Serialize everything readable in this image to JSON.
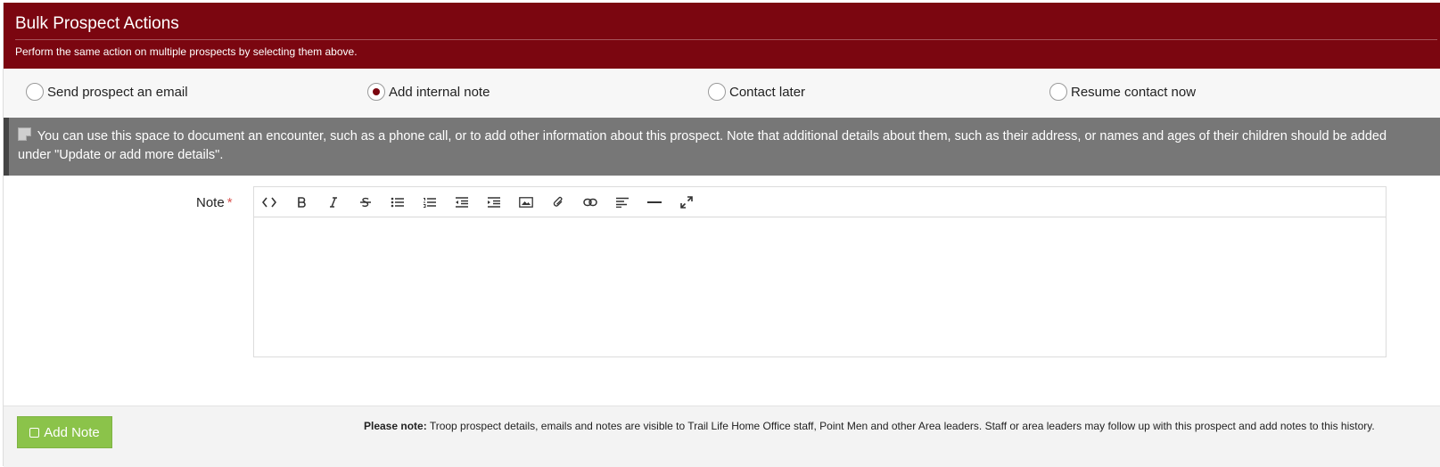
{
  "header": {
    "title": "Bulk Prospect Actions",
    "subtitle": "Perform the same action on multiple prospects by selecting them above."
  },
  "actions": [
    {
      "label": "Send prospect an email",
      "checked": false
    },
    {
      "label": "Add internal note",
      "checked": true
    },
    {
      "label": "Contact later",
      "checked": false
    },
    {
      "label": "Resume contact now",
      "checked": false
    }
  ],
  "info": {
    "text": "You can use this space to document an encounter, such as a phone call, or to add other information about this prospect. Note that additional details about them, such as their address, or names and ages of their children should be added under \"Update or add more details\"."
  },
  "form": {
    "note_label": "Note",
    "required_mark": "*",
    "editor_value": ""
  },
  "toolbar": {
    "tools": [
      "code-icon",
      "bold-icon",
      "italic-icon",
      "strikethrough-icon",
      "bullet-list-icon",
      "numbered-list-icon",
      "outdent-icon",
      "indent-icon",
      "image-icon",
      "attachment-icon",
      "link-icon",
      "align-icon",
      "horizontal-rule-icon",
      "fullscreen-icon"
    ]
  },
  "footer": {
    "add_button_label": "Add Note",
    "please_note_bold": "Please note:",
    "please_note_text": " Troop prospect details, emails and notes are visible to Trail Life Home Office staff, Point Men and other Area leaders. Staff or area leaders may follow up with this prospect and add notes to this history."
  },
  "colors": {
    "brand": "#7b0610",
    "info_bg": "#777777",
    "button_green": "#8bc34a"
  }
}
